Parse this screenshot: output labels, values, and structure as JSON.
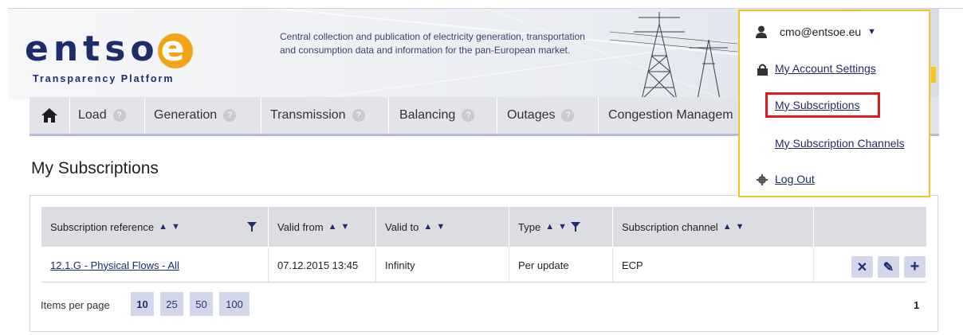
{
  "header": {
    "logo_text": "entso",
    "logo_e": "e",
    "logo_subtitle": "Transparency Platform",
    "tagline": "Central collection and publication of electricity generation, transportation and consumption data and information for the pan-European market."
  },
  "nav": {
    "items": [
      {
        "label": "Load"
      },
      {
        "label": "Generation"
      },
      {
        "label": "Transmission"
      },
      {
        "label": "Balancing"
      },
      {
        "label": "Outages"
      },
      {
        "label": "Congestion Managem"
      }
    ],
    "help_glyph": "?"
  },
  "page": {
    "title": "My Subscriptions"
  },
  "table": {
    "headers": [
      {
        "label": "Subscription reference",
        "sort": "▲ ▼",
        "filter": true
      },
      {
        "label": "Valid from",
        "sort": "▲ ▼"
      },
      {
        "label": "Valid to",
        "sort": "▲ ▼"
      },
      {
        "label": "Type",
        "sort": "▲ ▼",
        "filter": true
      },
      {
        "label": "Subscription channel",
        "sort": "▲ ▼"
      },
      {
        "label": ""
      }
    ],
    "rows": [
      {
        "reference": "12.1.G - Physical Flows - All",
        "valid_from": "07.12.2015 13:45",
        "valid_to": "Infinity",
        "type": "Per update",
        "channel": "ECP"
      }
    ],
    "actions": {
      "delete": "✕",
      "edit": "✎",
      "add": "+"
    }
  },
  "pagination": {
    "items_per_page_label": "Items per page",
    "sizes": [
      "10",
      "25",
      "50",
      "100"
    ],
    "selected_size": "10",
    "current_page": "1"
  },
  "user_menu": {
    "email": "cmo@entsoe.eu",
    "items": [
      {
        "label": "My Account Settings",
        "icon": "lock-icon"
      },
      {
        "label": "My Subscriptions",
        "icon": ""
      },
      {
        "label": "My Subscription Channels",
        "icon": ""
      },
      {
        "label": "Log Out",
        "icon": "gear-icon"
      }
    ]
  },
  "colors": {
    "brand_navy": "#1d2d6b",
    "brand_orange": "#f3a415",
    "menu_border": "#f2c622",
    "highlight_red": "#e0191f",
    "button_bg": "#d4d7ec"
  }
}
